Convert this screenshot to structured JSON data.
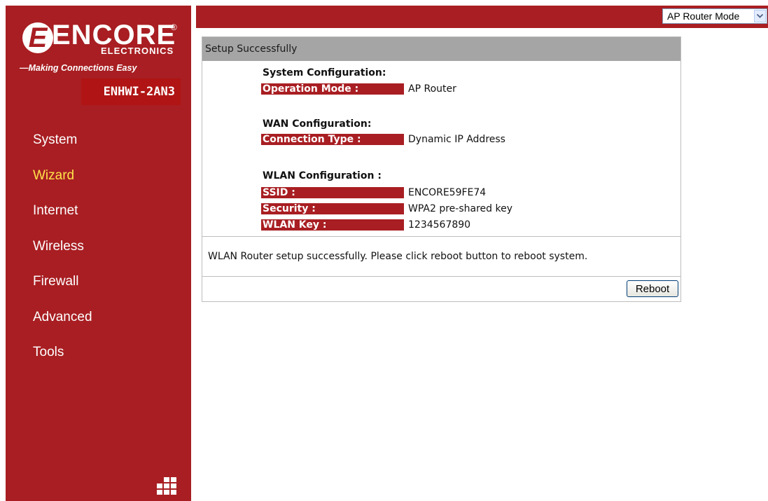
{
  "brand": {
    "logo_letter": "E",
    "name": "ENCORE",
    "reg_mark": "®",
    "sub": "ELECTRONICS",
    "tagline": "—Making Connections Easy",
    "model": "ENHWI-2AN3"
  },
  "nav": {
    "items": [
      {
        "label": "System",
        "active": false
      },
      {
        "label": "Wizard",
        "active": true
      },
      {
        "label": "Internet",
        "active": false
      },
      {
        "label": "Wireless",
        "active": false
      },
      {
        "label": "Firewall",
        "active": false
      },
      {
        "label": "Advanced",
        "active": false
      },
      {
        "label": "Tools",
        "active": false
      }
    ]
  },
  "mode_select": {
    "selected": "AP Router Mode"
  },
  "panel": {
    "title": "Setup Successfully",
    "sections": {
      "system": {
        "title": "System Configuration:",
        "rows": [
          {
            "label": "Operation Mode :",
            "value": "AP Router"
          }
        ]
      },
      "wan": {
        "title": "WAN Configuration:",
        "rows": [
          {
            "label": "Connection Type :",
            "value": "Dynamic IP Address"
          }
        ]
      },
      "wlan": {
        "title": "WLAN Configuration :",
        "rows": [
          {
            "label": "SSID :",
            "value": "ENCORE59FE74"
          },
          {
            "label": "Security :",
            "value": "WPA2 pre-shared key"
          },
          {
            "label": "WLAN Key :",
            "value": "1234567890"
          }
        ]
      }
    },
    "message": "WLAN Router setup successfully. Please click reboot button to reboot system.",
    "reboot_label": "Reboot"
  },
  "colors": {
    "brand_red": "#a81e22",
    "nav_active": "#ffe24a",
    "header_gray": "#a5a5a5"
  }
}
